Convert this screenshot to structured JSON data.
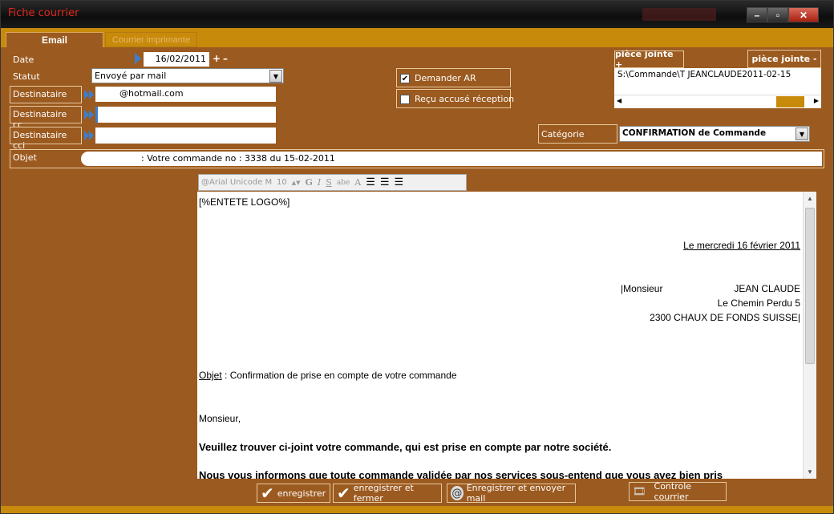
{
  "window": {
    "title": "Fiche  courrier",
    "controls": {
      "minimize": "–",
      "maximize": "▫",
      "close": "✕"
    }
  },
  "tabs": [
    {
      "label": "Email",
      "active": true
    },
    {
      "label": "Courrier imprimante",
      "active": false
    }
  ],
  "form": {
    "date_label": "Date",
    "date_value": "16/02/2011",
    "date_plus": "+",
    "date_minus": "–",
    "statut_label": "Statut",
    "statut_value": "Envoyé par mail",
    "destinataire_label": "Destinataire",
    "destinataire_value": "@hotmail.com",
    "destinataire_cc_label": "Destinataire cc",
    "destinataire_cc_value": "",
    "destinataire_cci_label": "Destinataire cci",
    "destinataire_cci_value": "",
    "objet_label": "Objet",
    "objet_value": ": Votre  commande no : 3338 du 15-02-2011",
    "demander_ar_label": "Demander AR",
    "demander_ar_checked": true,
    "recu_label": "Reçu accusé réception",
    "recu_checked": false,
    "piece_jointe_add": "pièce jointe +",
    "piece_jointe_remove": "pièce jointe -",
    "attachment_path": "S:\\Commande\\T         JEANCLAUDE2011-02-15",
    "categorie_label": "Catégorie",
    "categorie_value": "CONFIRMATION de Commande"
  },
  "toolbar": {
    "font": "@Arial Unicode MS",
    "size": "10",
    "bold": "G",
    "italic": "I",
    "strike": "S",
    "abc": "abe",
    "fontcolor": "A"
  },
  "letter": {
    "header": "[%ENTETE LOGO%]",
    "date": "Le mercredi 16 février 2011",
    "recipient_line1_prefix": "|Monsieur",
    "recipient_line1_name": "JEAN CLAUDE",
    "recipient_line2": "Le Chemin  Perdu 5",
    "recipient_line3": "2300 CHAUX DE FONDS SUISSE|",
    "objet_word": "Objet",
    "objet_text": " : Confirmation de prise en compte de votre commande",
    "salutation": "Monsieur,",
    "para1": "Veuillez trouver ci-joint votre commande, qui est prise en compte par notre société.",
    "para2": "Nous vous informons que toute commande validée par nos services sous-entend que vous avez bien pris"
  },
  "buttons": {
    "enregistrer": "enregistrer",
    "enregistrer_fermer": "enregistrer et fermer",
    "enregistrer_envoyer": "Enregistrer et envoyer mail",
    "controle": "Controle courrier"
  },
  "colors": {
    "background": "#9b5a1f",
    "tabbar": "#c78a0a",
    "title_text": "#e0281e"
  }
}
